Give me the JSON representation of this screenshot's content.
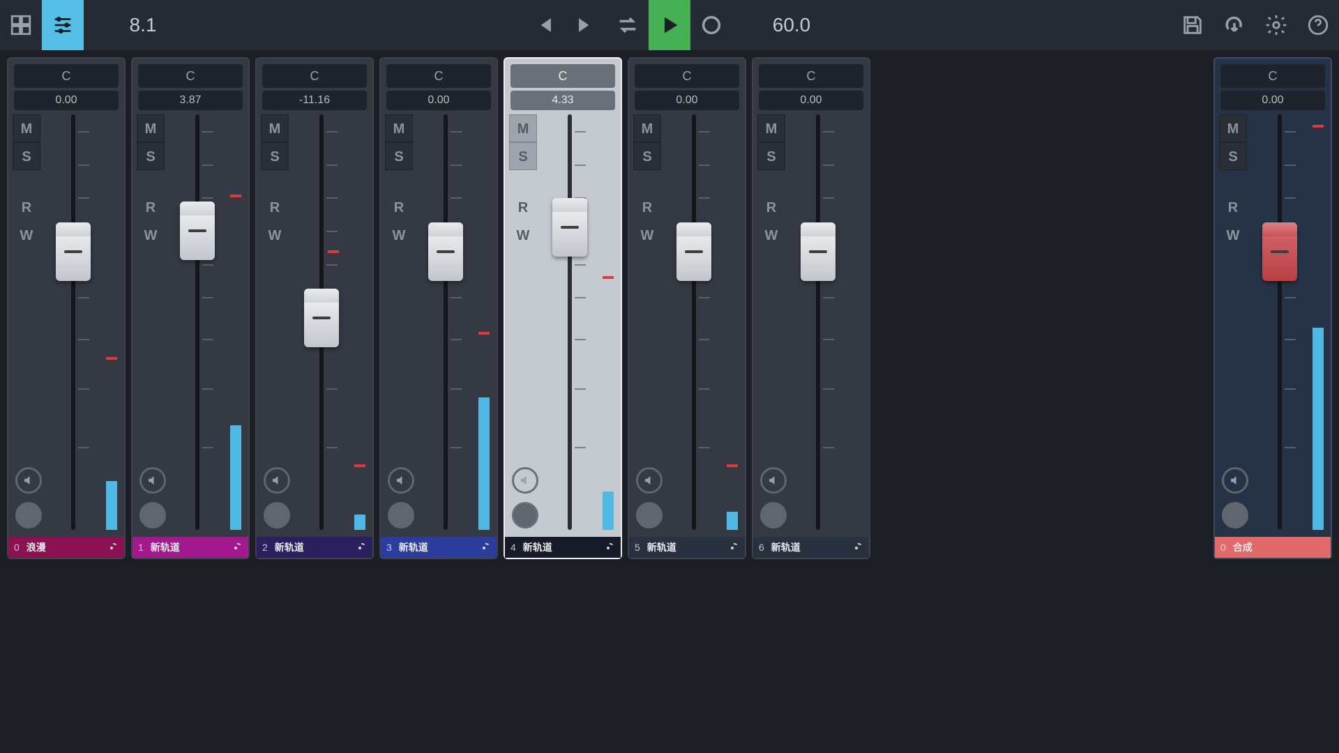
{
  "toolbar": {
    "position": "8.1",
    "tempo": "60.0"
  },
  "btn": {
    "M": "M",
    "S": "S",
    "R": "R",
    "W": "W"
  },
  "channels": [
    {
      "pan": "C",
      "db": "0.00",
      "faderTop": 155,
      "meterH": 70,
      "peakTop": 348,
      "idx": "0",
      "name": "浪漫",
      "color": "#8a1252",
      "sel": false
    },
    {
      "pan": "C",
      "db": "3.87",
      "faderTop": 125,
      "meterH": 150,
      "peakTop": 115,
      "idx": "1",
      "name": "新轨道",
      "color": "#a31a8e",
      "sel": false
    },
    {
      "pan": "C",
      "db": "-11.16",
      "faderTop": 250,
      "meterH": 22,
      "peakTop": 502,
      "idx": "2",
      "name": "新轨道",
      "color": "#2b1f5e",
      "sel": false
    },
    {
      "pan": "C",
      "db": "0.00",
      "faderTop": 155,
      "meterH": 190,
      "peakTop": 312,
      "idx": "3",
      "name": "新轨道",
      "color": "#2b3e9e",
      "sel": false
    },
    {
      "pan": "C",
      "db": "4.33",
      "faderTop": 120,
      "meterH": 55,
      "peakTop": 232,
      "idx": "4",
      "name": "新轨道",
      "color": "#161a29",
      "sel": true
    },
    {
      "pan": "C",
      "db": "0.00",
      "faderTop": 155,
      "meterH": 26,
      "peakTop": 502,
      "idx": "5",
      "name": "新轨道",
      "color": "#293140",
      "sel": false
    },
    {
      "pan": "C",
      "db": "0.00",
      "faderTop": 155,
      "meterH": 0,
      "peakTop": -100,
      "idx": "6",
      "name": "新轨道",
      "color": "#293140",
      "sel": false
    },
    {
      "pan": "C",
      "db": "0.00",
      "faderTop": 155,
      "meterH": 290,
      "peakTop": 15,
      "idx": "0",
      "name": "合成",
      "color": "#e26a6a",
      "master": true
    }
  ]
}
